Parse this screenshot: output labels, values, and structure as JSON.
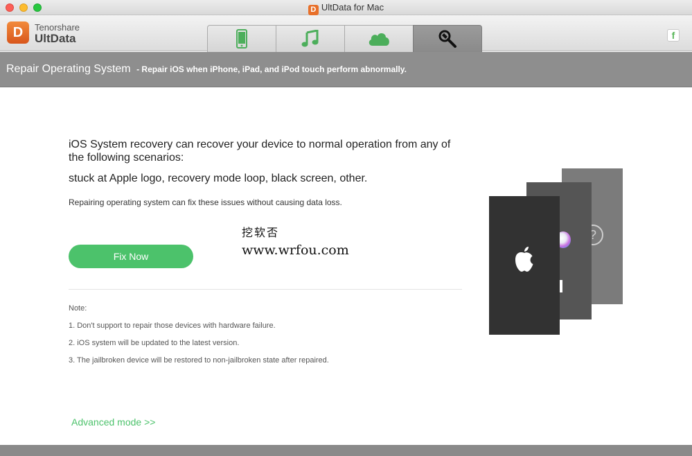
{
  "window": {
    "title": "UltData for Mac",
    "app_icon_letter": "D"
  },
  "brand": {
    "company": "Tenorshare",
    "product": "UltData",
    "logo_letter": "D"
  },
  "tabs": [
    {
      "id": "device",
      "icon": "phone-icon",
      "active": false
    },
    {
      "id": "itunes",
      "icon": "music-note-icon",
      "active": false
    },
    {
      "id": "icloud",
      "icon": "cloud-icon",
      "active": false
    },
    {
      "id": "repair",
      "icon": "wrench-magnifier-icon",
      "active": true
    }
  ],
  "social": {
    "facebook_label": "f"
  },
  "header": {
    "title": "Repair Operating System",
    "subtitle": "- Repair iOS when iPhone, iPad, and iPod touch perform abnormally."
  },
  "main": {
    "intro": "iOS System recovery can recover your device to normal operation from any of the following scenarios:",
    "scenarios": "stuck at Apple logo, recovery mode loop, black screen, other.",
    "no_data_loss": "Repairing operating system can fix these issues without causing data loss.",
    "fix_button": "Fix Now",
    "note_title": "Note:",
    "notes": [
      "1. Don't support to repair those devices with hardware failure.",
      "2. iOS system will be updated to the latest version.",
      "3. The jailbroken device will be restored to non-jailbroken state after repaired."
    ],
    "advanced_link": "Advanced mode >>"
  },
  "watermark": {
    "line1": "挖软否",
    "line2": "www.wrfou.com"
  },
  "illustration": {
    "help_glyph": "?"
  },
  "colors": {
    "accent_green": "#4cc26b",
    "header_gray": "#8e8e8e",
    "brand_orange": "#e8702a"
  }
}
